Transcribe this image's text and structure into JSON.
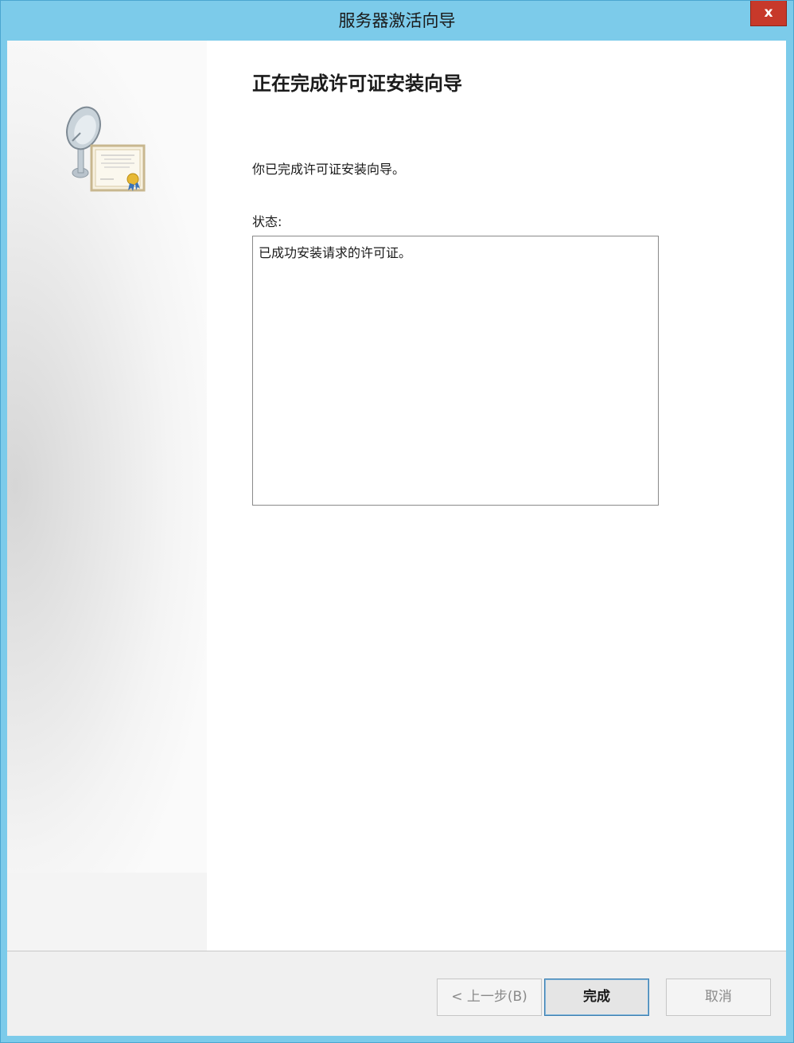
{
  "window": {
    "title": "服务器激活向导",
    "close_label": "x"
  },
  "page": {
    "heading": "正在完成许可证安装向导",
    "intro": "你已完成许可证安装向导。",
    "status_label": "状态:",
    "status_text": "已成功安装请求的许可证。"
  },
  "icons": {
    "wizard": "satellite-dish-certificate-icon",
    "close": "close-icon"
  },
  "buttons": {
    "back": "< 上一步(B)",
    "finish": "完成",
    "cancel": "取消"
  },
  "colors": {
    "titlebar": "#7ccbea",
    "close": "#c7392a",
    "footer": "#f0f0f0"
  }
}
